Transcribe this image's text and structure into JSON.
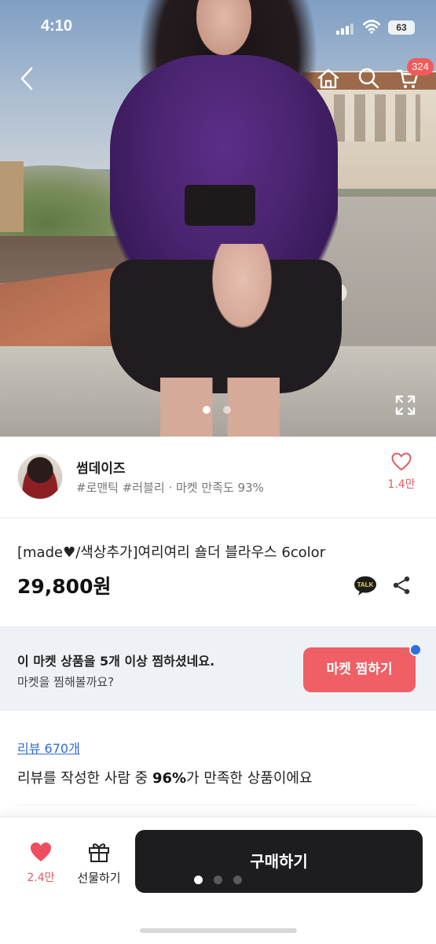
{
  "status_bar": {
    "time": "4:10",
    "battery": "63"
  },
  "nav": {
    "cart_count": "324"
  },
  "gallery": {
    "page_count": 2,
    "active_page": 1
  },
  "shop": {
    "name": "썸데이즈",
    "tags": "#로맨틱 #러블리 · 마켓 만족도 93%",
    "favorite_count": "1.4만"
  },
  "product": {
    "title": "[made♥/색상추가]여리여리 숄더 블라우스 6color",
    "price": "29,800원",
    "talk_label": "TALK"
  },
  "promo": {
    "line1": "이 마켓 상품을 5개 이상 찜하셨네요.",
    "line2": "마켓을 찜해볼까요?",
    "button": "마켓 찜하기"
  },
  "review": {
    "link": "리뷰 670개",
    "summary_prefix": "리뷰를 작성한 사람 중 ",
    "summary_highlight": "96%",
    "summary_suffix": "가 만족한 상품이에요"
  },
  "bottom_bar": {
    "like_count": "2.4만",
    "gift_label": "선물하기",
    "buy_label": "구매하기"
  },
  "colors": {
    "accent": "#ee5f66",
    "buy_button": "#1d1d1f",
    "link": "#2f6bd6",
    "promo_bg": "#eef1f6"
  }
}
